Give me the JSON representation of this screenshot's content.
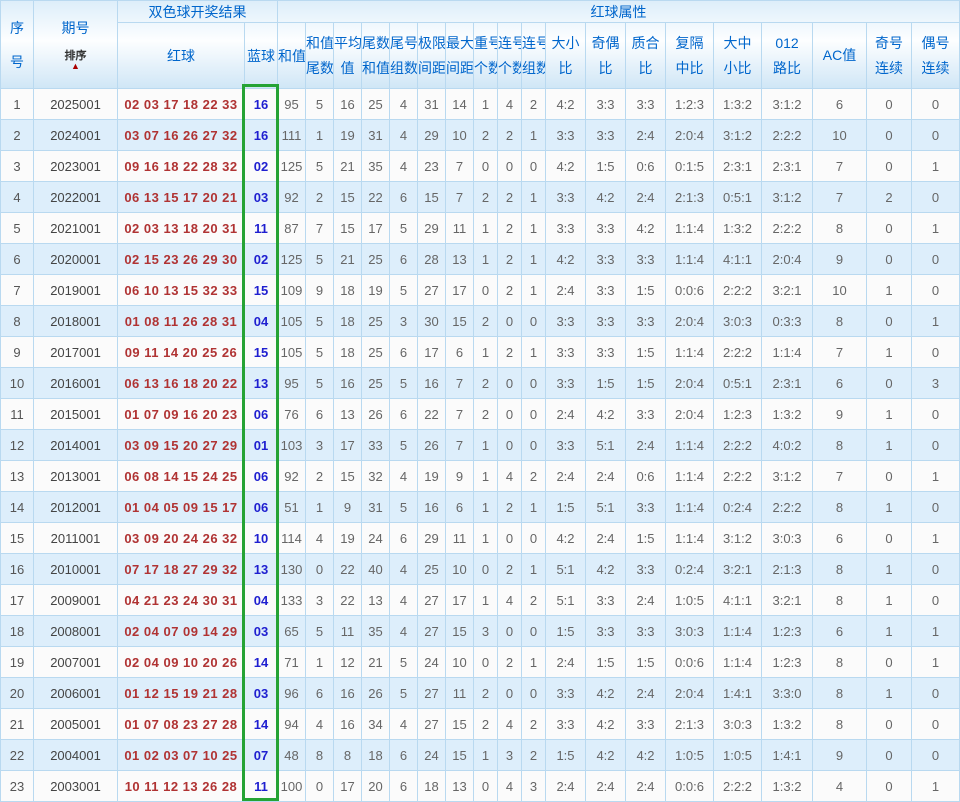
{
  "colors": {
    "header_text": "#0066cc",
    "red_ball": "#b03333",
    "blue_ball": "#1f1fd0",
    "highlight_border": "#25a335",
    "sort_arrow": "#aa0000",
    "row_alt": "#ddeefb",
    "grid_line": "#b9d9f0"
  },
  "table": {
    "header": {
      "seq_line1": "序",
      "seq_line2": "号",
      "period_title": "期号",
      "sort_label": "排序",
      "sort_arrow": "▲",
      "group_result": "双色球开奖结果",
      "group_attrs": "红球属性",
      "red": "红球",
      "blue": "蓝球",
      "sum": "和值",
      "attr_cols": [
        {
          "l1": "和值",
          "l2": "尾数"
        },
        {
          "l1": "平均",
          "l2": "值"
        },
        {
          "l1": "尾数",
          "l2": "和值"
        },
        {
          "l1": "尾号",
          "l2": "组数"
        },
        {
          "l1": "极限",
          "l2": "间距"
        },
        {
          "l1": "最大",
          "l2": "间距"
        },
        {
          "l1": "重号",
          "l2": "个数"
        },
        {
          "l1": "连号",
          "l2": "个数"
        },
        {
          "l1": "连号",
          "l2": "组数"
        },
        {
          "l1": "大小",
          "l2": "比"
        },
        {
          "l1": "奇偶",
          "l2": "比"
        },
        {
          "l1": "质合",
          "l2": "比"
        },
        {
          "l1": "复隔",
          "l2": "中比"
        },
        {
          "l1": "大中",
          "l2": "小比"
        },
        {
          "l1": "012",
          "l2": "路比"
        },
        {
          "l1": "AC值",
          "l2": ""
        },
        {
          "l1": "奇号",
          "l2": "连续"
        },
        {
          "l1": "偶号",
          "l2": "连续"
        }
      ]
    },
    "rows": [
      {
        "seq": "1",
        "period": "2025001",
        "red": "02 03 17 18 22 33",
        "blue": "16",
        "attrs": [
          "95",
          "5",
          "16",
          "25",
          "4",
          "31",
          "14",
          "1",
          "4",
          "2",
          "4:2",
          "3:3",
          "3:3",
          "1:2:3",
          "1:3:2",
          "3:1:2",
          "6",
          "0",
          "0"
        ]
      },
      {
        "seq": "2",
        "period": "2024001",
        "red": "03 07 16 26 27 32",
        "blue": "16",
        "attrs": [
          "111",
          "1",
          "19",
          "31",
          "4",
          "29",
          "10",
          "2",
          "2",
          "1",
          "3:3",
          "3:3",
          "2:4",
          "2:0:4",
          "3:1:2",
          "2:2:2",
          "10",
          "0",
          "0"
        ]
      },
      {
        "seq": "3",
        "period": "2023001",
        "red": "09 16 18 22 28 32",
        "blue": "02",
        "attrs": [
          "125",
          "5",
          "21",
          "35",
          "4",
          "23",
          "7",
          "0",
          "0",
          "0",
          "4:2",
          "1:5",
          "0:6",
          "0:1:5",
          "2:3:1",
          "2:3:1",
          "7",
          "0",
          "1"
        ]
      },
      {
        "seq": "4",
        "period": "2022001",
        "red": "06 13 15 17 20 21",
        "blue": "03",
        "attrs": [
          "92",
          "2",
          "15",
          "22",
          "6",
          "15",
          "7",
          "2",
          "2",
          "1",
          "3:3",
          "4:2",
          "2:4",
          "2:1:3",
          "0:5:1",
          "3:1:2",
          "7",
          "2",
          "0"
        ]
      },
      {
        "seq": "5",
        "period": "2021001",
        "red": "02 03 13 18 20 31",
        "blue": "11",
        "attrs": [
          "87",
          "7",
          "15",
          "17",
          "5",
          "29",
          "11",
          "1",
          "2",
          "1",
          "3:3",
          "3:3",
          "4:2",
          "1:1:4",
          "1:3:2",
          "2:2:2",
          "8",
          "0",
          "1"
        ]
      },
      {
        "seq": "6",
        "period": "2020001",
        "red": "02 15 23 26 29 30",
        "blue": "02",
        "attrs": [
          "125",
          "5",
          "21",
          "25",
          "6",
          "28",
          "13",
          "1",
          "2",
          "1",
          "4:2",
          "3:3",
          "3:3",
          "1:1:4",
          "4:1:1",
          "2:0:4",
          "9",
          "0",
          "0"
        ]
      },
      {
        "seq": "7",
        "period": "2019001",
        "red": "06 10 13 15 32 33",
        "blue": "15",
        "attrs": [
          "109",
          "9",
          "18",
          "19",
          "5",
          "27",
          "17",
          "0",
          "2",
          "1",
          "2:4",
          "3:3",
          "1:5",
          "0:0:6",
          "2:2:2",
          "3:2:1",
          "10",
          "1",
          "0"
        ]
      },
      {
        "seq": "8",
        "period": "2018001",
        "red": "01 08 11 26 28 31",
        "blue": "04",
        "attrs": [
          "105",
          "5",
          "18",
          "25",
          "3",
          "30",
          "15",
          "2",
          "0",
          "0",
          "3:3",
          "3:3",
          "3:3",
          "2:0:4",
          "3:0:3",
          "0:3:3",
          "8",
          "0",
          "1"
        ]
      },
      {
        "seq": "9",
        "period": "2017001",
        "red": "09 11 14 20 25 26",
        "blue": "15",
        "attrs": [
          "105",
          "5",
          "18",
          "25",
          "6",
          "17",
          "6",
          "1",
          "2",
          "1",
          "3:3",
          "3:3",
          "1:5",
          "1:1:4",
          "2:2:2",
          "1:1:4",
          "7",
          "1",
          "0"
        ]
      },
      {
        "seq": "10",
        "period": "2016001",
        "red": "06 13 16 18 20 22",
        "blue": "13",
        "attrs": [
          "95",
          "5",
          "16",
          "25",
          "5",
          "16",
          "7",
          "2",
          "0",
          "0",
          "3:3",
          "1:5",
          "1:5",
          "2:0:4",
          "0:5:1",
          "2:3:1",
          "6",
          "0",
          "3"
        ]
      },
      {
        "seq": "11",
        "period": "2015001",
        "red": "01 07 09 16 20 23",
        "blue": "06",
        "attrs": [
          "76",
          "6",
          "13",
          "26",
          "6",
          "22",
          "7",
          "2",
          "0",
          "0",
          "2:4",
          "4:2",
          "3:3",
          "2:0:4",
          "1:2:3",
          "1:3:2",
          "9",
          "1",
          "0"
        ]
      },
      {
        "seq": "12",
        "period": "2014001",
        "red": "03 09 15 20 27 29",
        "blue": "01",
        "attrs": [
          "103",
          "3",
          "17",
          "33",
          "5",
          "26",
          "7",
          "1",
          "0",
          "0",
          "3:3",
          "5:1",
          "2:4",
          "1:1:4",
          "2:2:2",
          "4:0:2",
          "8",
          "1",
          "0"
        ]
      },
      {
        "seq": "13",
        "period": "2013001",
        "red": "06 08 14 15 24 25",
        "blue": "06",
        "attrs": [
          "92",
          "2",
          "15",
          "32",
          "4",
          "19",
          "9",
          "1",
          "4",
          "2",
          "2:4",
          "2:4",
          "0:6",
          "1:1:4",
          "2:2:2",
          "3:1:2",
          "7",
          "0",
          "1"
        ]
      },
      {
        "seq": "14",
        "period": "2012001",
        "red": "01 04 05 09 15 17",
        "blue": "06",
        "attrs": [
          "51",
          "1",
          "9",
          "31",
          "5",
          "16",
          "6",
          "1",
          "2",
          "1",
          "1:5",
          "5:1",
          "3:3",
          "1:1:4",
          "0:2:4",
          "2:2:2",
          "8",
          "1",
          "0"
        ]
      },
      {
        "seq": "15",
        "period": "2011001",
        "red": "03 09 20 24 26 32",
        "blue": "10",
        "attrs": [
          "114",
          "4",
          "19",
          "24",
          "6",
          "29",
          "11",
          "1",
          "0",
          "0",
          "4:2",
          "2:4",
          "1:5",
          "1:1:4",
          "3:1:2",
          "3:0:3",
          "6",
          "0",
          "1"
        ]
      },
      {
        "seq": "16",
        "period": "2010001",
        "red": "07 17 18 27 29 32",
        "blue": "13",
        "attrs": [
          "130",
          "0",
          "22",
          "40",
          "4",
          "25",
          "10",
          "0",
          "2",
          "1",
          "5:1",
          "4:2",
          "3:3",
          "0:2:4",
          "3:2:1",
          "2:1:3",
          "8",
          "1",
          "0"
        ]
      },
      {
        "seq": "17",
        "period": "2009001",
        "red": "04 21 23 24 30 31",
        "blue": "04",
        "attrs": [
          "133",
          "3",
          "22",
          "13",
          "4",
          "27",
          "17",
          "1",
          "4",
          "2",
          "5:1",
          "3:3",
          "2:4",
          "1:0:5",
          "4:1:1",
          "3:2:1",
          "8",
          "1",
          "0"
        ]
      },
      {
        "seq": "18",
        "period": "2008001",
        "red": "02 04 07 09 14 29",
        "blue": "03",
        "attrs": [
          "65",
          "5",
          "11",
          "35",
          "4",
          "27",
          "15",
          "3",
          "0",
          "0",
          "1:5",
          "3:3",
          "3:3",
          "3:0:3",
          "1:1:4",
          "1:2:3",
          "6",
          "1",
          "1"
        ]
      },
      {
        "seq": "19",
        "period": "2007001",
        "red": "02 04 09 10 20 26",
        "blue": "14",
        "attrs": [
          "71",
          "1",
          "12",
          "21",
          "5",
          "24",
          "10",
          "0",
          "2",
          "1",
          "2:4",
          "1:5",
          "1:5",
          "0:0:6",
          "1:1:4",
          "1:2:3",
          "8",
          "0",
          "1"
        ]
      },
      {
        "seq": "20",
        "period": "2006001",
        "red": "01 12 15 19 21 28",
        "blue": "03",
        "attrs": [
          "96",
          "6",
          "16",
          "26",
          "5",
          "27",
          "11",
          "2",
          "0",
          "0",
          "3:3",
          "4:2",
          "2:4",
          "2:0:4",
          "1:4:1",
          "3:3:0",
          "8",
          "1",
          "0"
        ]
      },
      {
        "seq": "21",
        "period": "2005001",
        "red": "01 07 08 23 27 28",
        "blue": "14",
        "attrs": [
          "94",
          "4",
          "16",
          "34",
          "4",
          "27",
          "15",
          "2",
          "4",
          "2",
          "3:3",
          "4:2",
          "3:3",
          "2:1:3",
          "3:0:3",
          "1:3:2",
          "8",
          "0",
          "0"
        ]
      },
      {
        "seq": "22",
        "period": "2004001",
        "red": "01 02 03 07 10 25",
        "blue": "07",
        "attrs": [
          "48",
          "8",
          "8",
          "18",
          "6",
          "24",
          "15",
          "1",
          "3",
          "2",
          "1:5",
          "4:2",
          "4:2",
          "1:0:5",
          "1:0:5",
          "1:4:1",
          "9",
          "0",
          "0"
        ]
      },
      {
        "seq": "23",
        "period": "2003001",
        "red": "10 11 12 13 26 28",
        "blue": "11",
        "attrs": [
          "100",
          "0",
          "17",
          "20",
          "6",
          "18",
          "13",
          "0",
          "4",
          "3",
          "2:4",
          "2:4",
          "2:4",
          "0:0:6",
          "2:2:2",
          "1:3:2",
          "4",
          "0",
          "1"
        ]
      }
    ]
  }
}
